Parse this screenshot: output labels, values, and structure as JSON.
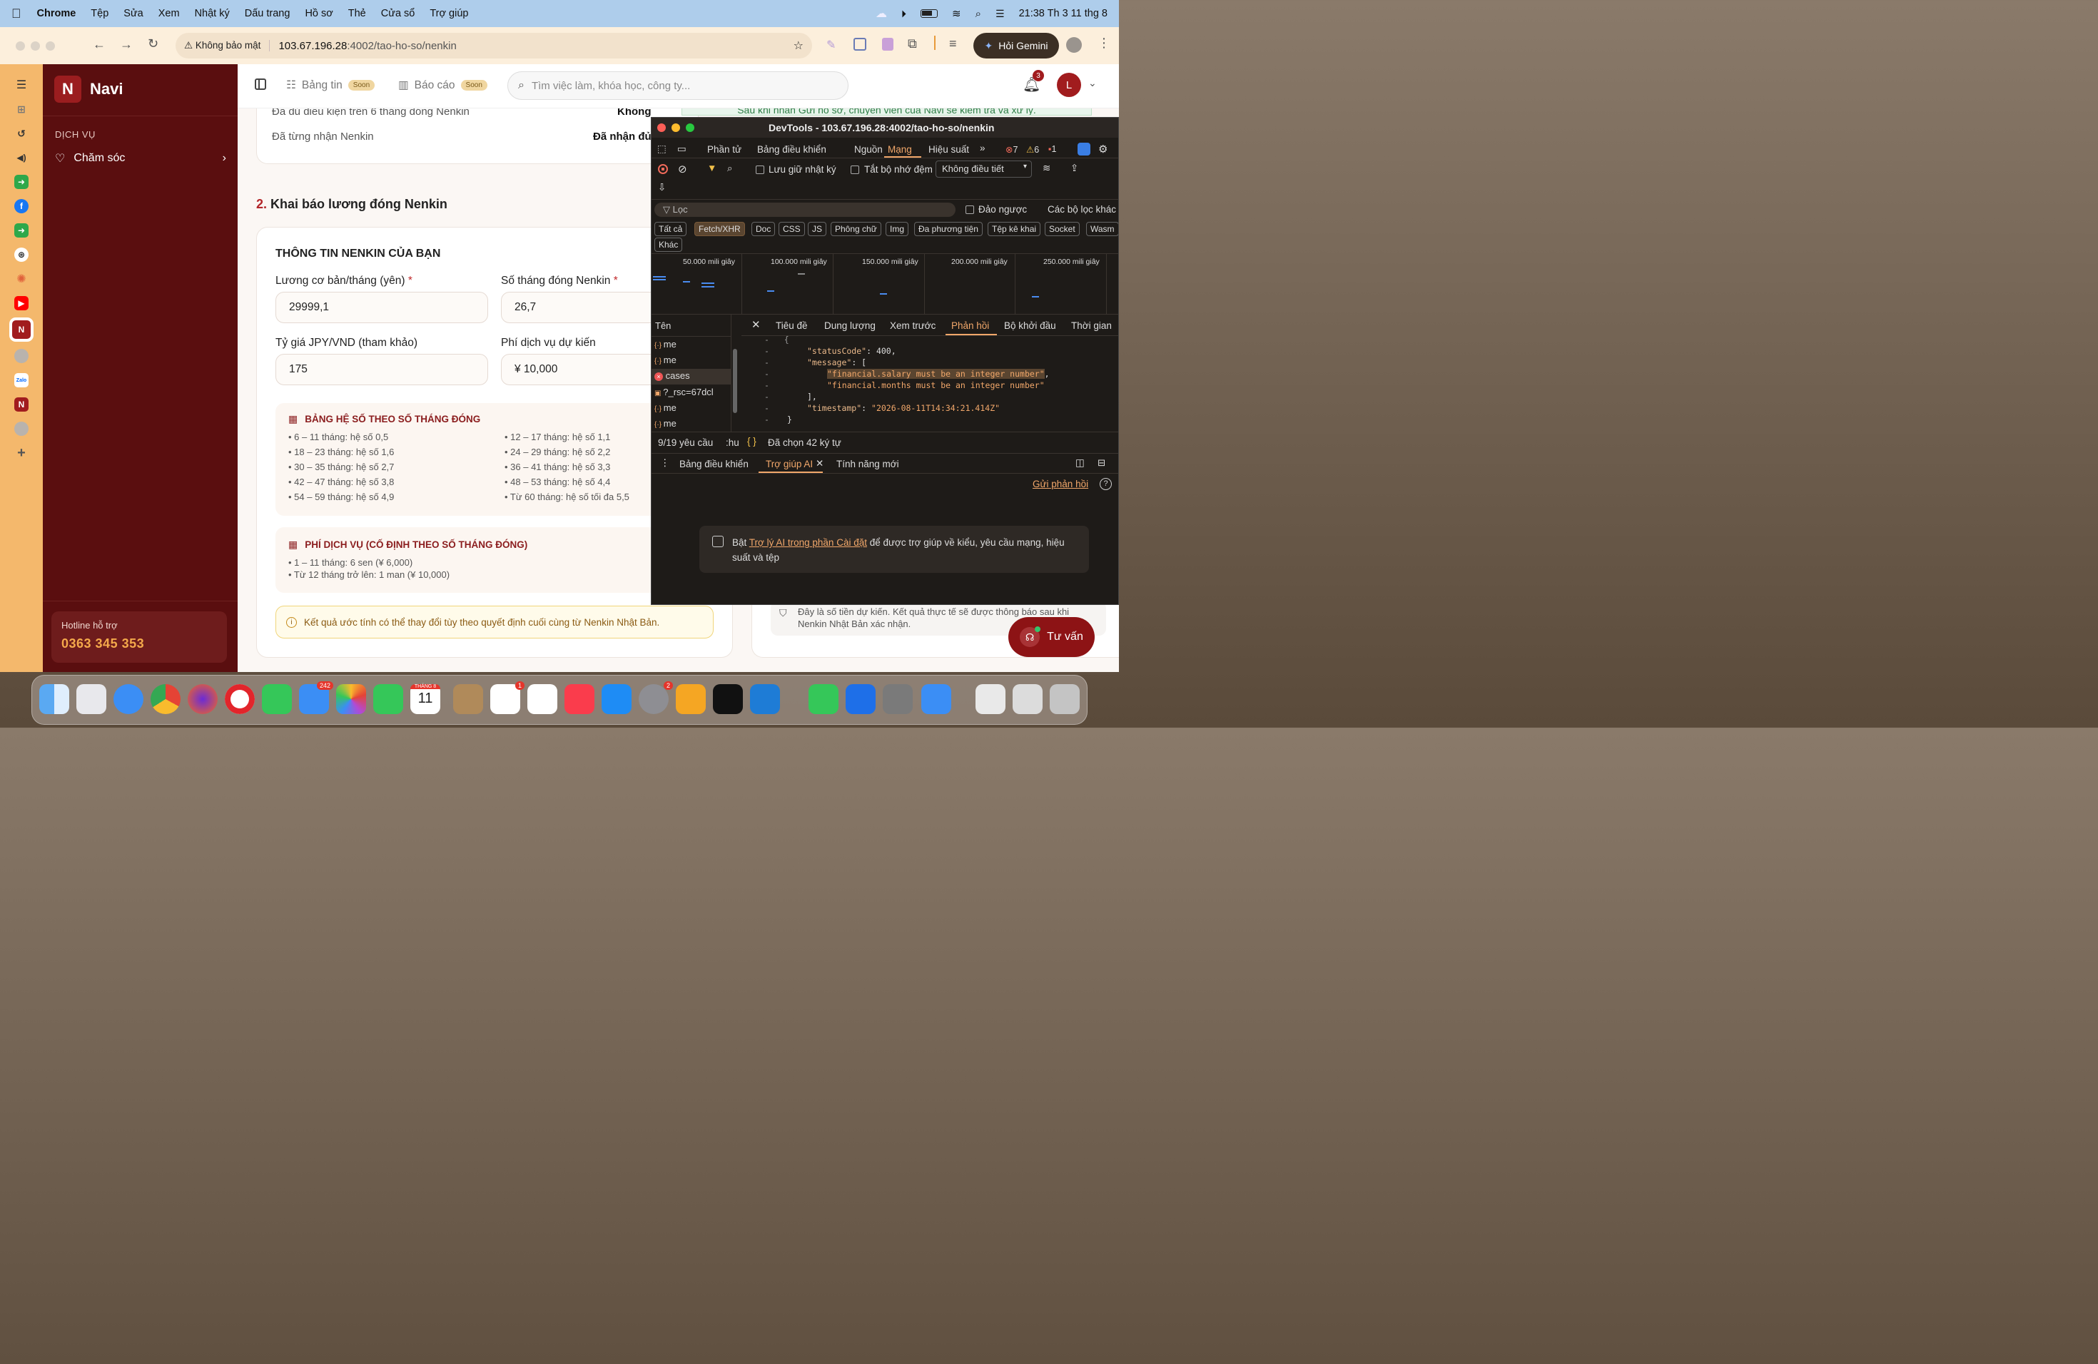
{
  "menubar": {
    "app": "Chrome",
    "items": [
      "Tệp",
      "Sửa",
      "Xem",
      "Nhật ký",
      "Dấu trang",
      "Hồ sơ",
      "Thẻ",
      "Cửa sổ",
      "Trợ giúp"
    ],
    "clock": "21:38 Th 3 11 thg 8"
  },
  "browser": {
    "security_label": "Không bảo mật",
    "url_host": "103.67.196.28",
    "url_path": ":4002/tao-ho-so/nenkin",
    "gemini_label": "Hỏi Gemini"
  },
  "sidebar": {
    "brand": "Navi",
    "section_label": "DỊCH VỤ",
    "item_label": "Chăm sóc",
    "hotline_label": "Hotline hỗ trợ",
    "hotline_number": "0363 345 353"
  },
  "topbar": {
    "tab1_label": "Bảng tin",
    "tab1_badge": "Soon",
    "tab2_label": "Báo cáo",
    "tab2_badge": "Soon",
    "search_placeholder": "Tìm việc làm, khóa học, công ty...",
    "notif_count": "3",
    "avatar_initial": "L"
  },
  "main": {
    "row1_label": "Đã đủ điều kiện trên 6 tháng đóng Nenkin",
    "row1_value": "Không",
    "row2_label": "Đã từng nhận Nenkin",
    "row2_value": "Đã nhận đủ",
    "section_number": "2.",
    "section_title": "Khai báo lương đóng Nenkin",
    "info_title": "THÔNG TIN NENKIN CỦA BẠN",
    "salary_label": "Lương cơ bản/tháng (yên)",
    "salary_value": "29999,1",
    "months_label": "Số tháng đóng Nenkin",
    "months_value": "26,7",
    "rate_label": "Tỷ giá JPY/VND (tham khảo)",
    "rate_value": "175",
    "fee_label": "Phí dịch vụ dự kiến",
    "fee_value": "¥ 10,000",
    "required_mark": "*",
    "coef_title": "BẢNG HỆ SỐ THEO SỐ THÁNG ĐÓNG",
    "coef_left": [
      "• 6 – 11 tháng: hệ số 0,5",
      "• 18 – 23 tháng: hệ số 1,6",
      "• 30 – 35 tháng: hệ số 2,7",
      "• 42 – 47 tháng: hệ số 3,8",
      "• 54 – 59 tháng: hệ số 4,9"
    ],
    "coef_right": [
      "• 12 – 17 tháng: hệ số 1,1",
      "• 24 – 29 tháng: hệ số 2,2",
      "• 36 – 41 tháng: hệ số 3,3",
      "• 48 – 53 tháng: hệ số 4,4",
      "• Từ 60 tháng: hệ số tối đa 5,5"
    ],
    "svc_title": "PHÍ DỊCH VỤ (CỐ ĐỊNH THEO SỐ THÁNG ĐÓNG)",
    "svc_items": [
      "• 1 – 11 tháng: 6 sen (¥ 6,000)",
      "• Từ 12 tháng trở lên: 1 man (¥ 10,000)"
    ],
    "notice": "Kết quả ước tính có thể thay đổi tùy theo quyết định cuối cùng từ Nenkin Nhật Bản.",
    "right_banner": "Sau khi nhấn Gửi hồ sơ, chuyên viên của Navi sẽ kiểm tra và xử lý.",
    "right_note": "Đây là số tiền dự kiến. Kết quả thực tế sẽ được thông báo sau khi Nenkin Nhật Bản xác nhận.",
    "consult_label": "Tư vấn"
  },
  "devtools": {
    "title": "DevTools - 103.67.196.28:4002/tao-ho-so/nenkin",
    "tabs": [
      "Phần tử",
      "Bảng điều khiển",
      "Nguồn",
      "Mạng",
      "Hiệu suất"
    ],
    "err_count": "7",
    "warn_count": "6",
    "info_count": "1",
    "preserve_log": "Lưu giữ nhật ký",
    "disable_cache": "Tắt bộ nhớ đệm",
    "throttle": "Không điều tiết",
    "filter_placeholder": "Lọc",
    "invert": "Đảo ngược",
    "more_filters": "Các bộ lọc khác",
    "chips": [
      "Tất cả",
      "Fetch/XHR",
      "Doc",
      "CSS",
      "JS",
      "Phông chữ",
      "Img",
      "Đa phương tiện",
      "Tệp kê khai",
      "Socket",
      "Wasm",
      "Khác"
    ],
    "ticks": [
      "50.000 mili giây",
      "100.000 mili giây",
      "150.000 mili giây",
      "200.000 mili giây",
      "250.000 mili giây"
    ],
    "name_header": "Tên",
    "requests": [
      "me",
      "me",
      "cases",
      "?_rsc=67dcl",
      "me",
      "me"
    ],
    "detail_tabs": [
      "Tiêu đề",
      "Dung lượng",
      "Xem trước",
      "Phản hồi",
      "Bộ khởi đầu",
      "Thời gian"
    ],
    "resp_line1_key": "\"statusCode\"",
    "resp_line1_val": "400,",
    "resp_line2_key": "\"message\"",
    "resp_line2_rest": ": [",
    "resp_line3": "\"financial.salary must be an integer number\"",
    "resp_line4": "\"financial.months must be an integer number\"",
    "resp_line5": "],",
    "resp_line6_key": "\"timestamp\"",
    "resp_line6_val": "\"2026-08-11T14:34:21.414Z\"",
    "status_requests": "9/19 yêu cầu",
    "status_trunc": ":hu",
    "status_selected": "Đã chọn 42 ký tự",
    "drawer_tabs": [
      "Bảng điều khiển",
      "Trợ giúp AI",
      "Tính năng mới"
    ],
    "feedback_link": "Gửi phản hồi",
    "ai_msg_prefix": "Bật ",
    "ai_msg_link": "Trợ lý AI trong phần Cài đặt",
    "ai_msg_suffix": " để được trợ giúp về kiểu, yêu cầu mạng, hiệu suất và tệp"
  },
  "dock": {
    "mail_badge": "242",
    "calendar_month": "THÁNG 8",
    "calendar_day": "11",
    "reminders_badge": "1",
    "settings_badge": "2"
  },
  "colors": {
    "brand": "#5a0e0f",
    "accent": "#8d1315",
    "sidebar_strip": "#f4b86c",
    "devtools_bg": "#1e1b18"
  }
}
